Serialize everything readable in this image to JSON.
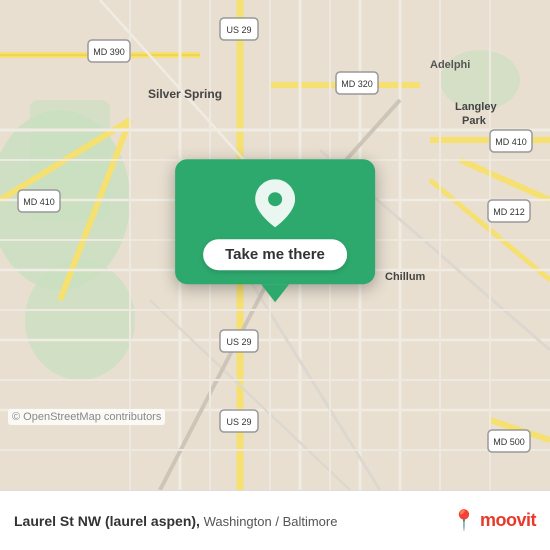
{
  "map": {
    "background_color": "#e8dfd0",
    "copyright": "© OpenStreetMap contributors"
  },
  "popup": {
    "background_color": "#2ea96e",
    "icon": "location-pin-icon",
    "button_label": "Take me there"
  },
  "footer": {
    "location_name": "Laurel St NW (laurel aspen),",
    "location_region": "Washington / Baltimore",
    "pin_icon": "📍",
    "brand_name": "moovit"
  }
}
